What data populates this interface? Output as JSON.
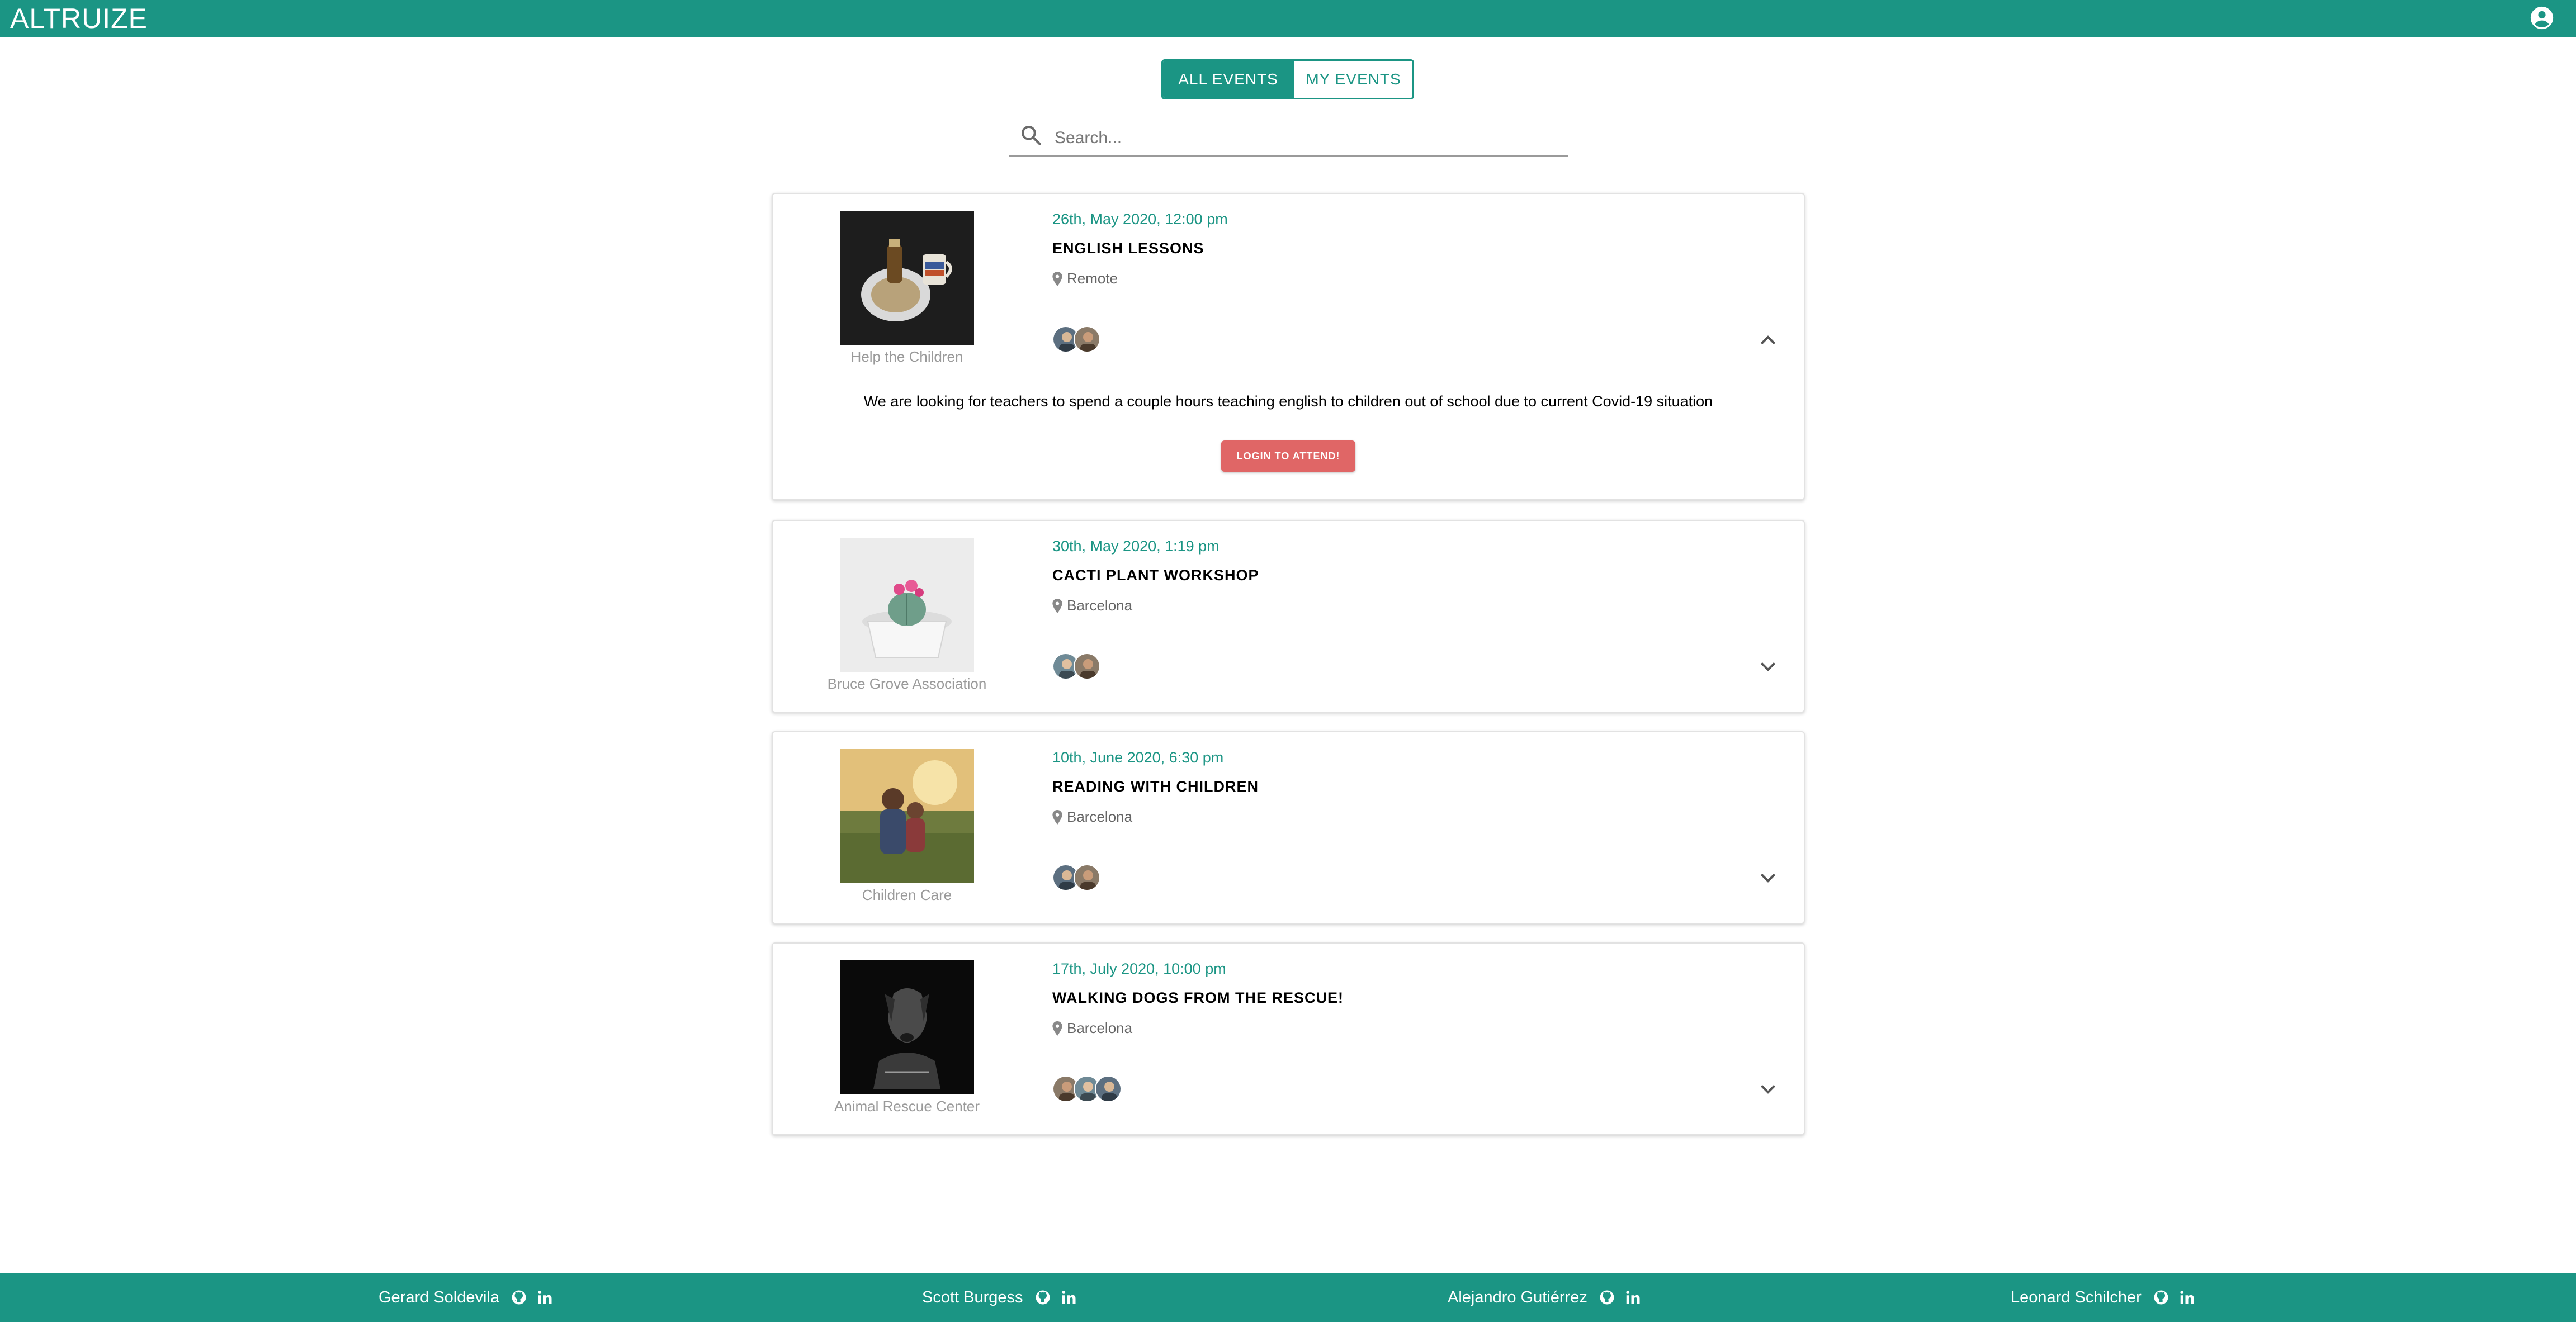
{
  "header": {
    "logo": "ALTRUIZE",
    "account_icon": "account-circle-icon"
  },
  "tabs": [
    {
      "label": "ALL EVENTS",
      "active": true
    },
    {
      "label": "MY EVENTS",
      "active": false
    }
  ],
  "search": {
    "placeholder": "Search...",
    "value": ""
  },
  "events": [
    {
      "organization": "Help the Children",
      "date": "26th, May 2020, 12:00 pm",
      "title": "ENGLISH LESSONS",
      "location": "Remote",
      "attendees": 2,
      "expanded": true,
      "description": "We are looking for teachers to spend a couple hours teaching english to children out of school due to current Covid-19 situation",
      "action_label": "LOGIN TO ATTEND!"
    },
    {
      "organization": "Bruce Grove Association",
      "date": "30th, May 2020, 1:19 pm",
      "title": "CACTI PLANT WORKSHOP",
      "location": "Barcelona",
      "attendees": 2,
      "expanded": false
    },
    {
      "organization": "Children Care",
      "date": "10th, June 2020, 6:30 pm",
      "title": "READING WITH CHILDREN",
      "location": "Barcelona",
      "attendees": 2,
      "expanded": false
    },
    {
      "organization": "Animal Rescue Center",
      "date": "17th, July 2020, 10:00 pm",
      "title": "WALKING DOGS FROM THE RESCUE!",
      "location": "Barcelona",
      "attendees": 3,
      "expanded": false
    }
  ],
  "footer": {
    "members": [
      {
        "name": "Gerard Soldevila"
      },
      {
        "name": "Scott Burgess"
      },
      {
        "name": "Alejandro Gutiérrez"
      },
      {
        "name": "Leonard Schilcher"
      }
    ]
  },
  "colors": {
    "brand": "#1b9584",
    "attend_button": "#e06666",
    "muted_text": "#9a9a9a"
  }
}
